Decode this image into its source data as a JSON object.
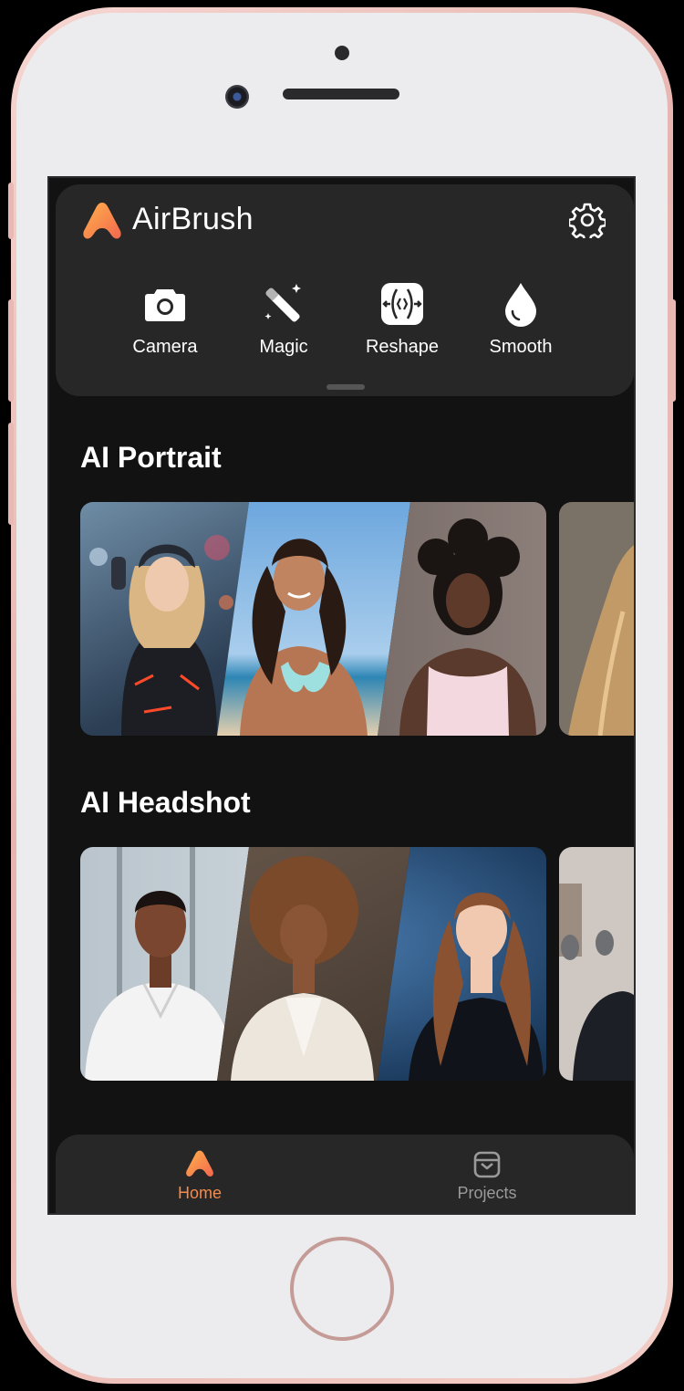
{
  "app": {
    "name": "AirBrush"
  },
  "tools": [
    {
      "label": "Camera",
      "icon": "camera-icon"
    },
    {
      "label": "Magic",
      "icon": "magic-wand-icon"
    },
    {
      "label": "Reshape",
      "icon": "reshape-icon"
    },
    {
      "label": "Smooth",
      "icon": "drop-icon"
    }
  ],
  "sections": [
    {
      "title": "AI Portrait"
    },
    {
      "title": "AI Headshot"
    }
  ],
  "tabbar": {
    "items": [
      {
        "label": "Home",
        "icon": "airbrush-logo-icon",
        "active": true
      },
      {
        "label": "Projects",
        "icon": "projects-box-icon",
        "active": false
      }
    ]
  },
  "colors": {
    "accent": "#F58A4B",
    "inactive": "#9A9A9A",
    "background": "#121212",
    "card": "#272727"
  }
}
